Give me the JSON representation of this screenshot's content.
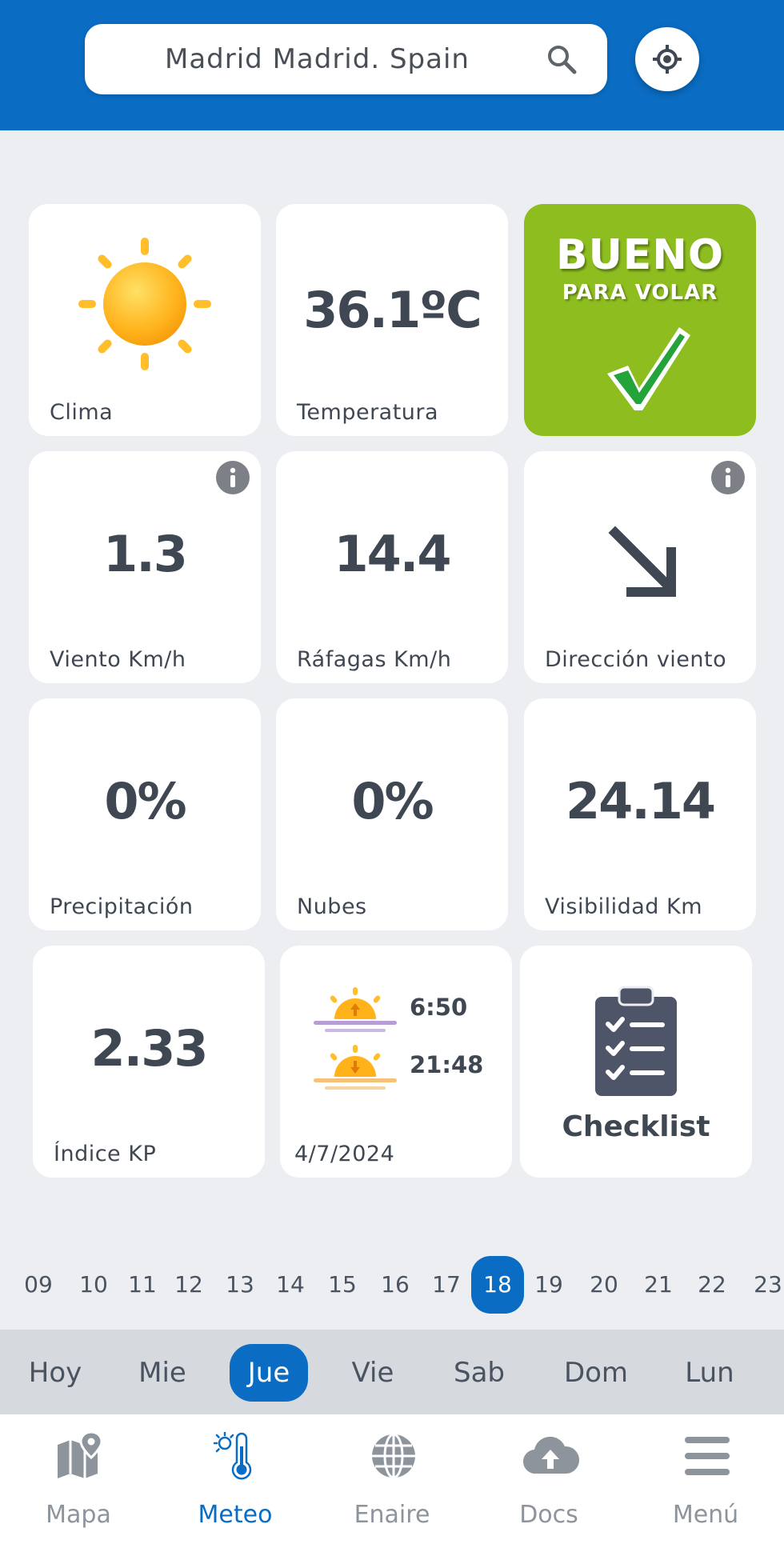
{
  "search": {
    "location": "Madrid Madrid. Spain"
  },
  "tiles": {
    "clima": {
      "label": "Clima"
    },
    "temperatura": {
      "value": "36.1ºC",
      "label": "Temperatura"
    },
    "status": {
      "title": "BUENO",
      "subtitle": "PARA VOLAR"
    },
    "viento": {
      "value": "1.3",
      "label": "Viento Km/h"
    },
    "rafagas": {
      "value": "14.4",
      "label": "Ráfagas Km/h"
    },
    "direccion": {
      "label": "Dirección viento"
    },
    "precipitacion": {
      "value": "0%",
      "label": "Precipitación"
    },
    "nubes": {
      "value": "0%",
      "label": "Nubes"
    },
    "visibilidad": {
      "value": "24.14",
      "label": "Visibilidad Km"
    },
    "kp": {
      "value": "2.33",
      "label": "Índice KP"
    },
    "sun": {
      "sunrise": "6:50",
      "sunset": "21:48",
      "date": "4/7/2024"
    },
    "checklist": {
      "label": "Checklist"
    }
  },
  "hours": [
    "09",
    "10",
    "11",
    "12",
    "13",
    "14",
    "15",
    "16",
    "17",
    "18",
    "19",
    "20",
    "21",
    "22",
    "23"
  ],
  "selected_hour": "18",
  "days": [
    "Hoy",
    "Mie",
    "Jue",
    "Vie",
    "Sab",
    "Dom",
    "Lun"
  ],
  "selected_day": "Jue",
  "nav": {
    "mapa": "Mapa",
    "meteo": "Meteo",
    "enaire": "Enaire",
    "docs": "Docs",
    "menu": "Menú"
  },
  "colors": {
    "primary": "#0a6cc2",
    "good": "#8dbd1f",
    "text": "#3f4753"
  },
  "icons": {
    "search": "search-icon",
    "locate": "crosshair-icon",
    "clima": "sun-icon",
    "status": "checkmark-icon",
    "info": "info-icon",
    "direccion": "arrow-down-right-icon",
    "sunrise": "sunrise-icon",
    "sunset": "sunset-icon",
    "checklist": "clipboard-icon",
    "mapa": "map-pin-icon",
    "meteo": "thermometer-sun-icon",
    "enaire": "globe-icon",
    "docs": "cloud-upload-icon",
    "menu": "hamburger-icon"
  }
}
